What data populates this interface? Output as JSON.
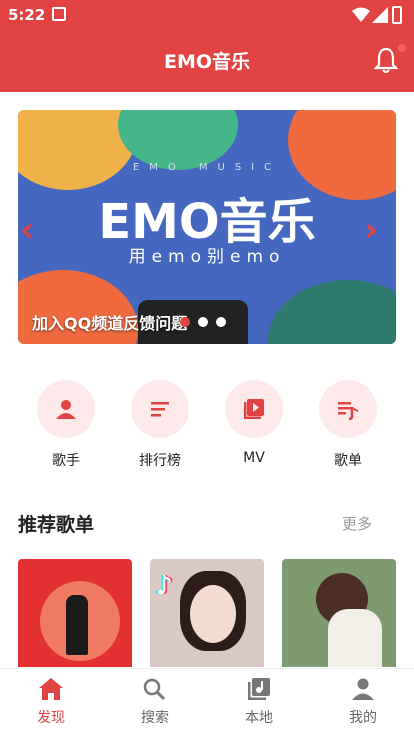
{
  "status_bar": {
    "time": "5:22"
  },
  "header": {
    "title": "EMO音乐"
  },
  "banner": {
    "subtitle": "EMO MUSIC",
    "headline": "EMO音乐",
    "slogan": "用emo别emo",
    "caption": "加入QQ频道反馈问题",
    "dot_count": 3,
    "active_dot": 0
  },
  "quick_actions": [
    {
      "label": "歌手",
      "icon": "person-icon"
    },
    {
      "label": "排行榜",
      "icon": "ranking-list-icon"
    },
    {
      "label": "MV",
      "icon": "video-icon"
    },
    {
      "label": "歌单",
      "icon": "playlist-icon"
    }
  ],
  "recommend": {
    "title": "推荐歌单",
    "more": "更多"
  },
  "bottom_nav": [
    {
      "label": "发现",
      "icon": "home-icon",
      "active": true
    },
    {
      "label": "搜索",
      "icon": "search-icon",
      "active": false
    },
    {
      "label": "本地",
      "icon": "local-music-icon",
      "active": false
    },
    {
      "label": "我的",
      "icon": "profile-icon",
      "active": false
    }
  ],
  "colors": {
    "accent": "#e14343",
    "accent_light": "#fde9e9"
  }
}
